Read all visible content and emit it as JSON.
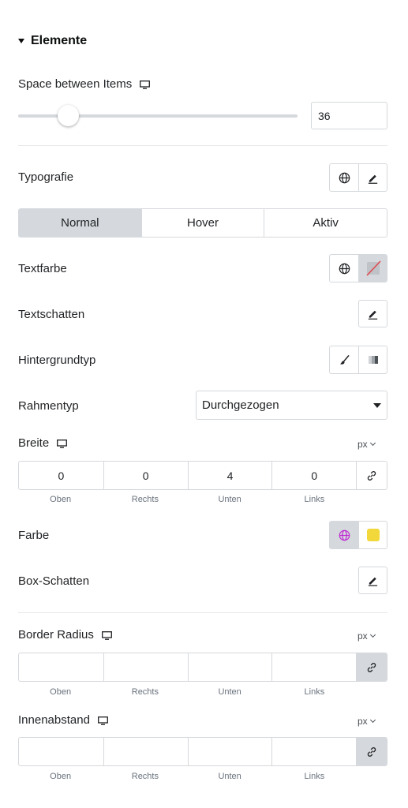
{
  "section": {
    "title": "Elemente"
  },
  "space_between": {
    "label": "Space between Items",
    "value": "36",
    "slider_fraction": 0.18
  },
  "typografie": {
    "label": "Typografie"
  },
  "tabs": [
    {
      "label": "Normal",
      "active": true
    },
    {
      "label": "Hover",
      "active": false
    },
    {
      "label": "Aktiv",
      "active": false
    }
  ],
  "textfarbe": {
    "label": "Textfarbe"
  },
  "textschatten": {
    "label": "Textschatten"
  },
  "hintergrundtyp": {
    "label": "Hintergrundtyp"
  },
  "rahmentyp": {
    "label": "Rahmentyp",
    "selected": "Durchgezogen"
  },
  "breite": {
    "label": "Breite",
    "unit": "px",
    "values": [
      "0",
      "0",
      "4",
      "0"
    ],
    "sides": [
      "Oben",
      "Rechts",
      "Unten",
      "Links"
    ]
  },
  "farbe": {
    "label": "Farbe",
    "swatch_color": "#f2d83b",
    "globe_color": "#c026d3"
  },
  "box_schatten": {
    "label": "Box-Schatten"
  },
  "border_radius": {
    "label": "Border Radius",
    "unit": "px",
    "values": [
      "",
      "",
      "",
      ""
    ],
    "sides": [
      "Oben",
      "Rechts",
      "Unten",
      "Links"
    ]
  },
  "innenabstand": {
    "label": "Innenabstand",
    "unit": "px",
    "values": [
      "",
      "",
      "",
      ""
    ],
    "sides": [
      "Oben",
      "Rechts",
      "Unten",
      "Links"
    ]
  }
}
